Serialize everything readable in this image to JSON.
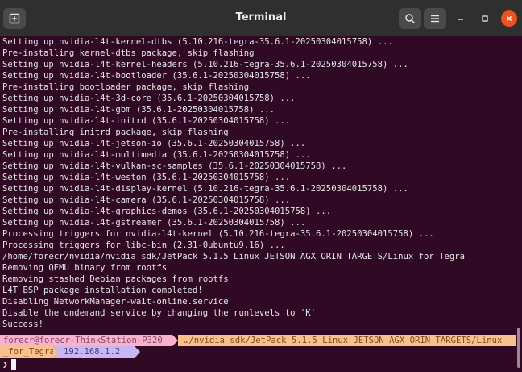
{
  "window": {
    "title": "Terminal"
  },
  "icons": {
    "new_tab": "new-tab-icon",
    "search": "search-icon",
    "menu": "hamburger-menu-icon",
    "minimize": "minimize-icon",
    "maximize": "maximize-icon",
    "close": "close-icon"
  },
  "colors": {
    "terminal_bg": "#300a24",
    "titlebar_bg": "#2f2f2f",
    "close_button": "#e95420",
    "prompt_user_bg": "#fbb1cd",
    "prompt_path_bg": "#f9bf8c",
    "prompt_ip_bg": "#c9b6f5"
  },
  "output": [
    "Setting up nvidia-l4t-kernel-dtbs (5.10.216-tegra-35.6.1-20250304015758) ...",
    "Pre-installing kernel-dtbs package, skip flashing",
    "Setting up nvidia-l4t-kernel-headers (5.10.216-tegra-35.6.1-20250304015758) ...",
    "Setting up nvidia-l4t-bootloader (35.6.1-20250304015758) ...",
    "Pre-installing bootloader package, skip flashing",
    "Setting up nvidia-l4t-3d-core (35.6.1-20250304015758) ...",
    "Setting up nvidia-l4t-gbm (35.6.1-20250304015758) ...",
    "Setting up nvidia-l4t-initrd (35.6.1-20250304015758) ...",
    "Pre-installing initrd package, skip flashing",
    "Setting up nvidia-l4t-jetson-io (35.6.1-20250304015758) ...",
    "Setting up nvidia-l4t-multimedia (35.6.1-20250304015758) ...",
    "Setting up nvidia-l4t-vulkan-sc-samples (35.6.1-20250304015758) ...",
    "Setting up nvidia-l4t-weston (35.6.1-20250304015758) ...",
    "Setting up nvidia-l4t-display-kernel (5.10.216-tegra-35.6.1-20250304015758) ...",
    "Setting up nvidia-l4t-camera (35.6.1-20250304015758) ...",
    "Setting up nvidia-l4t-graphics-demos (35.6.1-20250304015758) ...",
    "Setting up nvidia-l4t-gstreamer (35.6.1-20250304015758) ...",
    "Processing triggers for nvidia-l4t-kernel (5.10.216-tegra-35.6.1-20250304015758) ...",
    "Processing triggers for libc-bin (2.31-0ubuntu9.16) ...",
    "/home/forecr/nvidia/nvidia_sdk/JetPack_5.1.5_Linux_JETSON_AGX_ORIN_TARGETS/Linux_for_Tegra",
    "Removing QEMU binary from rootfs",
    "Removing stashed Debian packages from rootfs",
    "L4T BSP package installation completed!",
    "Disabling NetworkManager-wait-online.service",
    "Disable the ondemand service by changing the runlevels to 'K'",
    "Success!"
  ],
  "prompt": {
    "user_host": "forecr@forecr-ThinkStation-P320",
    "path_line1": "…/nvidia_sdk/JetPack_5.1.5_Linux_JETSON_AGX_ORIN_TARGETS/Linux",
    "path_line2": "_for_Tegra",
    "ip": "192.168.1.2",
    "prompt_char": "❯"
  }
}
